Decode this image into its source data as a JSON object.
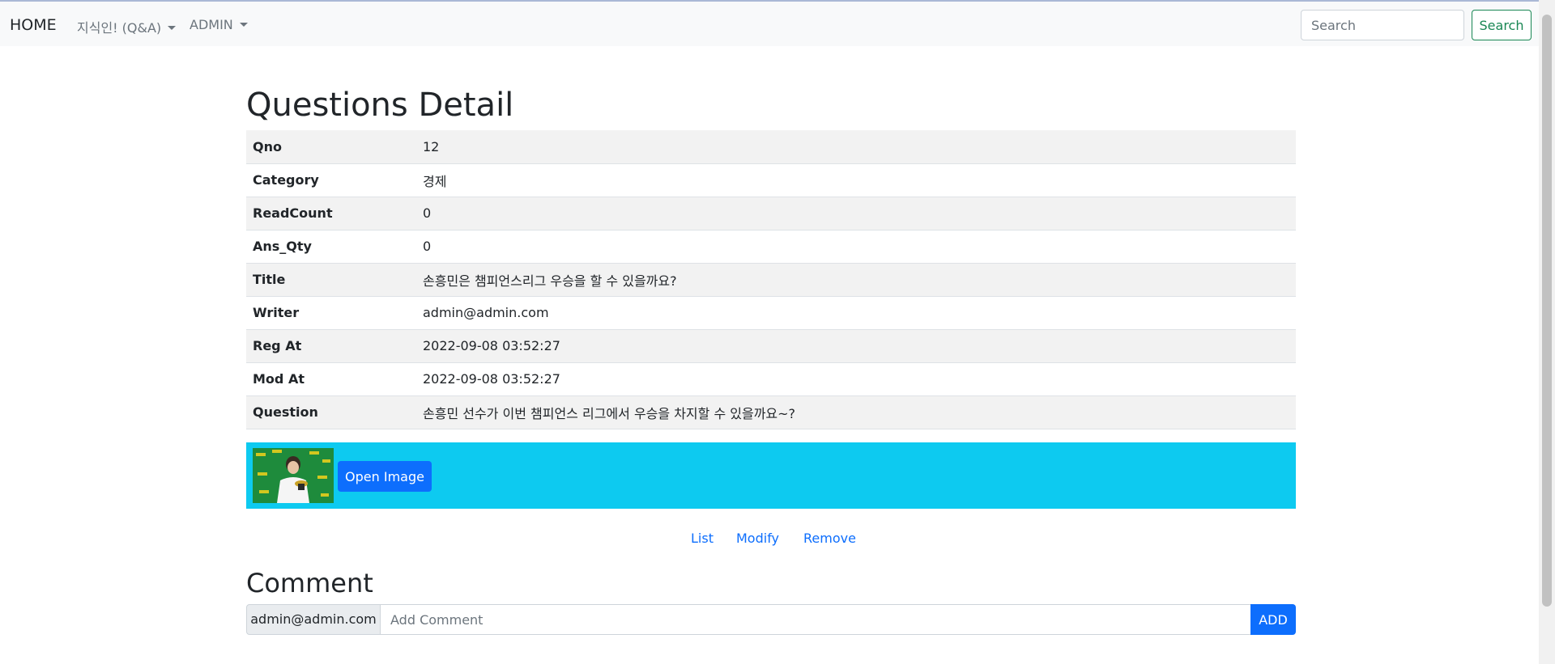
{
  "navbar": {
    "brand": "HOME",
    "menu1": "지식인! (Q&A)",
    "menu2": "ADMIN",
    "search_placeholder": "Search",
    "search_button": "Search"
  },
  "page_title": "Questions Detail",
  "detail_rows": [
    {
      "label": "Qno",
      "value": "12"
    },
    {
      "label": "Category",
      "value": "경제"
    },
    {
      "label": "ReadCount",
      "value": "0"
    },
    {
      "label": "Ans_Qty",
      "value": "0"
    },
    {
      "label": "Title",
      "value": "손흥민은 챔피언스리그 우승을 할 수 있을까요?"
    },
    {
      "label": "Writer",
      "value": "admin@admin.com"
    },
    {
      "label": "Reg At",
      "value": "2022-09-08 03:52:27"
    },
    {
      "label": "Mod At",
      "value": "2022-09-08 03:52:27"
    },
    {
      "label": "Question",
      "value": "손흥민 선수가 이번 챔피언스 리그에서 우승을 차지할 수 있을까요~?"
    }
  ],
  "image_section": {
    "open_button": "Open Image"
  },
  "actions": {
    "list": "List",
    "modify": "Modify",
    "remove": "Remove"
  },
  "comment": {
    "title": "Comment",
    "writer": "admin@admin.com",
    "placeholder": "Add Comment",
    "add_button": "ADD"
  },
  "colors": {
    "primary": "#0d6efd",
    "info": "#0dcaf0",
    "success": "#198754"
  }
}
